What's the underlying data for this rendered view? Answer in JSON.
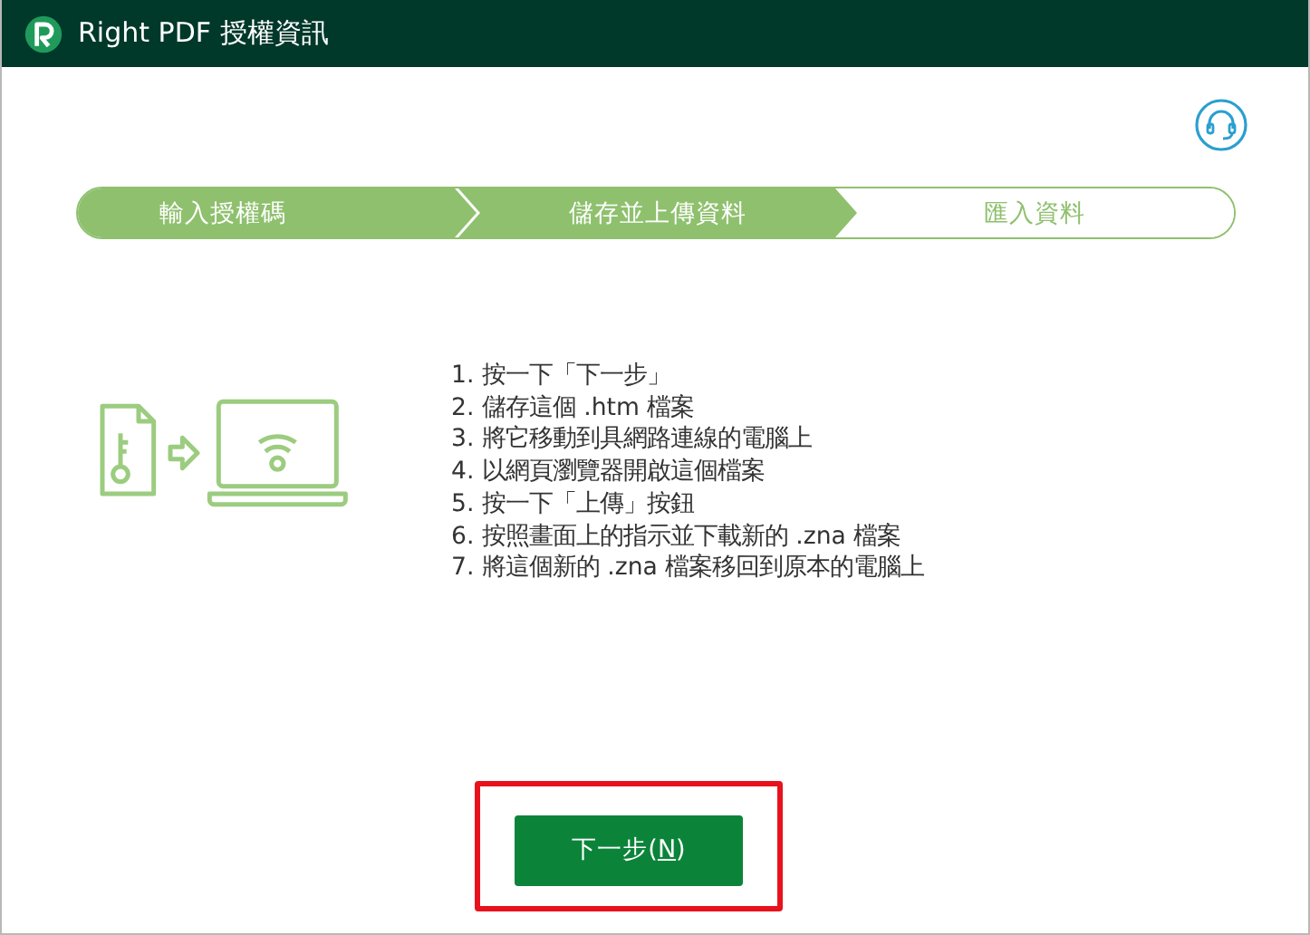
{
  "window": {
    "title": "Right PDF 授權資訊"
  },
  "steps": [
    {
      "label": "輸入授權碼",
      "done": true
    },
    {
      "label": "儲存並上傳資料",
      "done": true
    },
    {
      "label": "匯入資料",
      "done": false
    }
  ],
  "instructions": [
    "1. 按一下「下一步」",
    "2. 儲存這個 .htm 檔案",
    "3. 將它移動到具網路連線的電腦上",
    "4. 以網頁瀏覽器開啟這個檔案",
    "5. 按一下「上傳」按鈕",
    "6. 按照畫面上的指示並下載新的 .zna 檔案",
    "7. 將這個新的 .zna 檔案移回到原本的電腦上"
  ],
  "next_button": {
    "label_before": "下一步(",
    "access_key": "N",
    "label_after": ")",
    "highlighted": true
  }
}
